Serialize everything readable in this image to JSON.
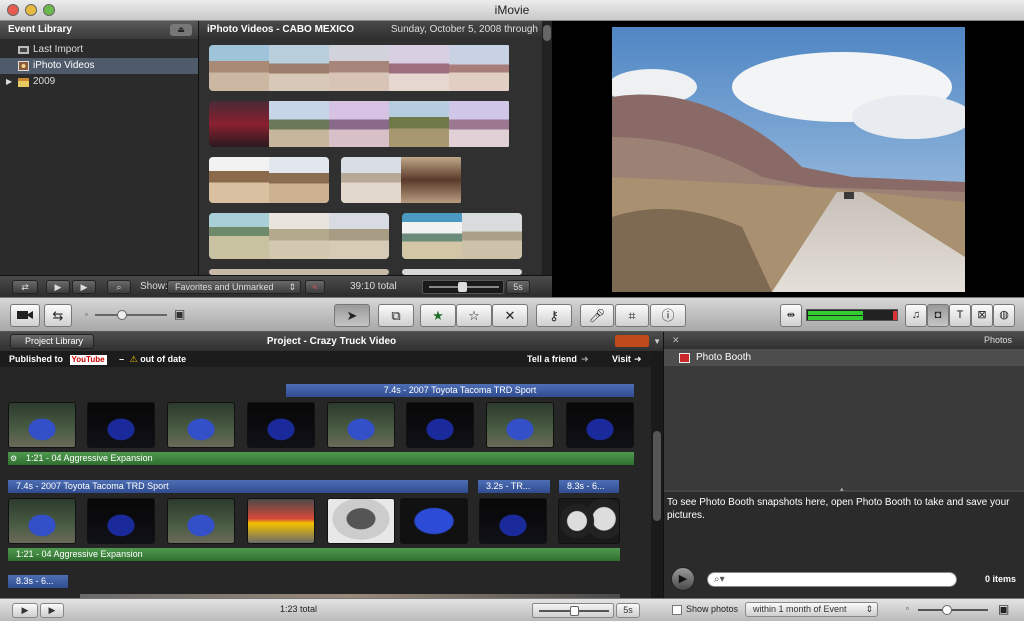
{
  "app": {
    "title": "iMovie"
  },
  "event_library": {
    "title": "Event Library",
    "items": [
      {
        "label": "Last Import"
      },
      {
        "label": "iPhoto Videos"
      },
      {
        "label": "2009"
      }
    ]
  },
  "event_browser": {
    "title": "iPhoto Videos - CABO MEXICO",
    "date": "Sunday, October 5, 2008 through",
    "show_label": "Show:",
    "show_value": "Favorites and Unmarked",
    "total": "39:10 total",
    "zoom_value": "5s"
  },
  "project": {
    "back_label": "Project Library",
    "title": "Project - Crazy Truck Video",
    "published_prefix": "Published to",
    "published_service": "YouTube",
    "out_of_date": "out of date",
    "tell_friend": "Tell a friend",
    "visit": "Visit",
    "row1_title": "7.4s - 2007 Toyota Tacoma TRD Sport",
    "row1_music": "1:21 - 04 Aggressive Expansion",
    "row2_title": "7.4s - 2007 Toyota Tacoma TRD Sport",
    "row2_title_b": "3.2s - TR...",
    "row2_title_c": "8.3s - 6...",
    "row2_music": "1:21 - 04 Aggressive Expansion",
    "row3_title": "8.3s - 6...",
    "total": "1:23 total",
    "zoom_value": "5s"
  },
  "photos": {
    "header": "Photos",
    "item": "Photo Booth",
    "info": "To see Photo Booth snapshots here, open Photo Booth to take and save your pictures.",
    "search_placeholder": "",
    "count": "0 items",
    "show_photos_label": "Show photos",
    "show_photos_value": "within 1 month of Event"
  },
  "icons": {
    "camera": "camera-icon",
    "swap": "swap-icon",
    "pointer": "pointer-icon",
    "crop": "crop-icon"
  }
}
